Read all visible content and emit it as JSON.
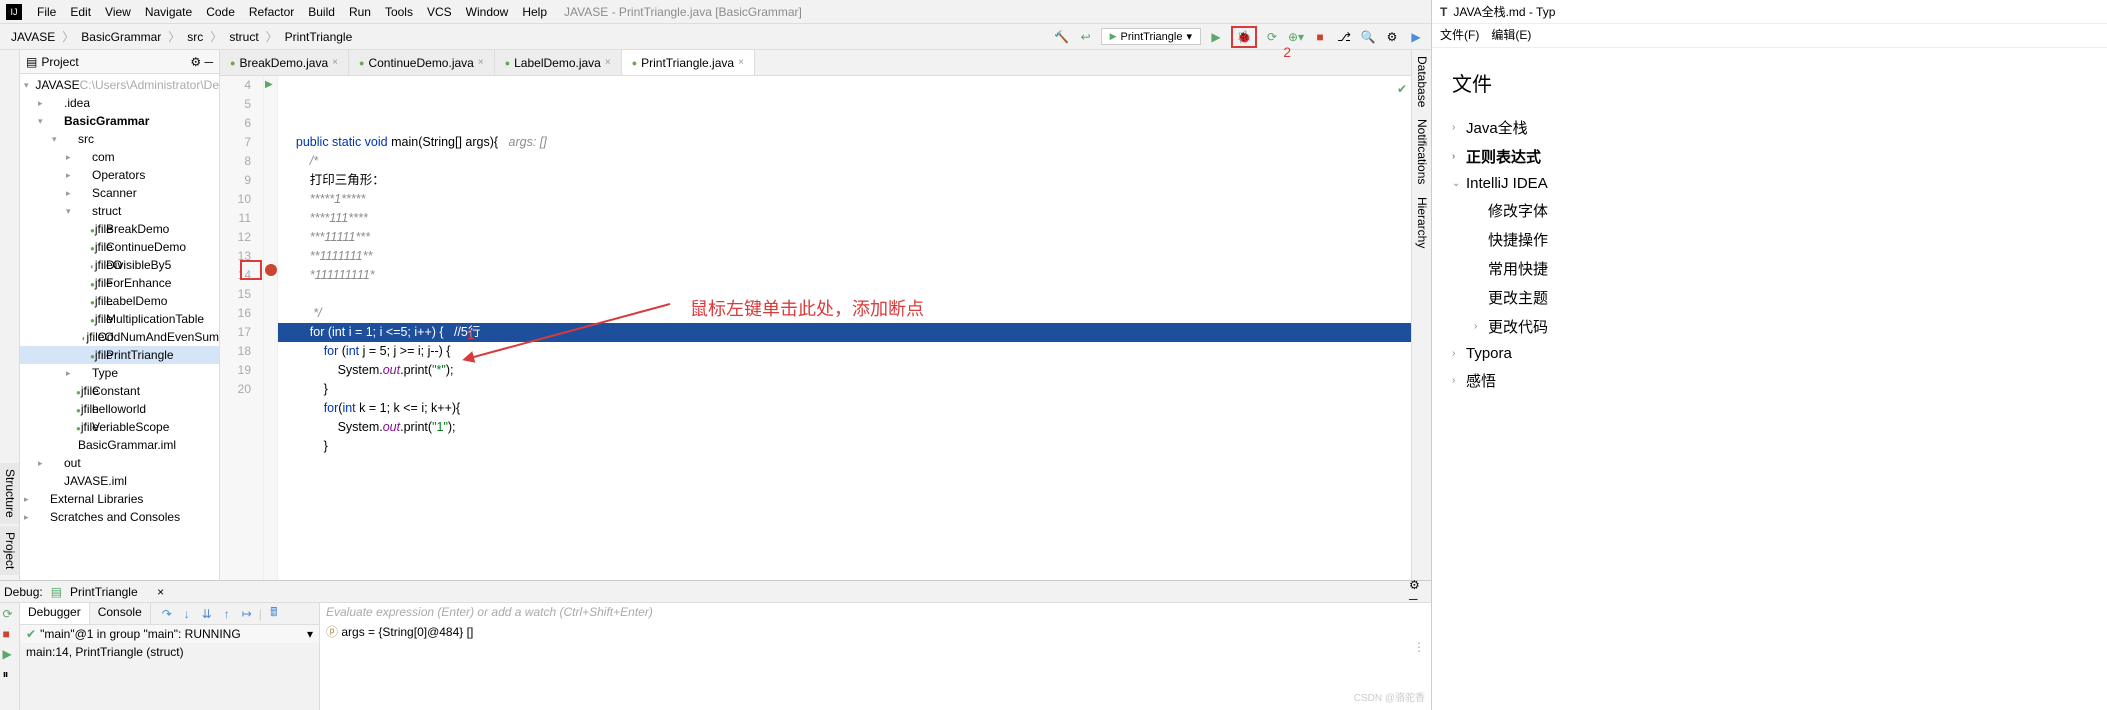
{
  "menubar": {
    "items": [
      "File",
      "Edit",
      "View",
      "Navigate",
      "Code",
      "Refactor",
      "Build",
      "Run",
      "Tools",
      "VCS",
      "Window",
      "Help"
    ],
    "title": "JAVASE - PrintTriangle.java [BasicGrammar]"
  },
  "crumbs": [
    "JAVASE",
    "BasicGrammar",
    "src",
    "struct",
    "PrintTriangle"
  ],
  "run_config": "PrintTriangle",
  "annotations": {
    "label1": "1",
    "label2": "2",
    "text": "鼠标左键单击此处，添加断点"
  },
  "project_tree": {
    "header": "Project",
    "nodes": [
      {
        "d": 0,
        "arrow": "▾",
        "ic": "📁",
        "label": "JAVASE",
        "suffix": "C:\\Users\\Administrator\\De"
      },
      {
        "d": 1,
        "arrow": "▸",
        "ic": "📁",
        "label": ".idea"
      },
      {
        "d": 1,
        "arrow": "▾",
        "ic": "📁",
        "label": "BasicGrammar",
        "bold": true
      },
      {
        "d": 2,
        "arrow": "▾",
        "ic": "📁",
        "label": "src"
      },
      {
        "d": 3,
        "arrow": "▸",
        "ic": "📁",
        "label": "com"
      },
      {
        "d": 3,
        "arrow": "▸",
        "ic": "📁",
        "label": "Operators"
      },
      {
        "d": 3,
        "arrow": "▸",
        "ic": "📁",
        "label": "Scanner"
      },
      {
        "d": 3,
        "arrow": "▾",
        "ic": "📁",
        "label": "struct"
      },
      {
        "d": 4,
        "ic": "jfile",
        "label": "BreakDemo"
      },
      {
        "d": 4,
        "ic": "jfile",
        "label": "ContinueDemo"
      },
      {
        "d": 4,
        "ic": "jfileO",
        "label": "DivisibleBy5"
      },
      {
        "d": 4,
        "ic": "jfile",
        "label": "ForEnhance"
      },
      {
        "d": 4,
        "ic": "jfile",
        "label": "LabelDemo"
      },
      {
        "d": 4,
        "ic": "jfile",
        "label": "MultiplicationTable"
      },
      {
        "d": 4,
        "ic": "jfileO",
        "label": "OddNumAndEvenSum"
      },
      {
        "d": 4,
        "ic": "jfile",
        "label": "PrintTriangle",
        "sel": true
      },
      {
        "d": 3,
        "arrow": "▸",
        "ic": "📁",
        "label": "Type"
      },
      {
        "d": 3,
        "ic": "jfile",
        "label": "Constant"
      },
      {
        "d": 3,
        "ic": "jfile",
        "label": "helloworld"
      },
      {
        "d": 3,
        "ic": "jfile",
        "label": "VeriableScope"
      },
      {
        "d": 2,
        "ic": "⚙",
        "label": "BasicGrammar.iml"
      },
      {
        "d": 1,
        "arrow": "▸",
        "ic": "📁",
        "label": "out",
        "orange": true
      },
      {
        "d": 1,
        "ic": "⚙",
        "label": "JAVASE.iml"
      },
      {
        "d": 0,
        "arrow": "▸",
        "ic": "📚",
        "label": "External Libraries"
      },
      {
        "d": 0,
        "arrow": "▸",
        "ic": "🗂",
        "label": "Scratches and Consoles"
      }
    ]
  },
  "editor": {
    "tabs": [
      {
        "label": "BreakDemo.java"
      },
      {
        "label": "ContinueDemo.java"
      },
      {
        "label": "LabelDemo.java"
      },
      {
        "label": "PrintTriangle.java",
        "active": true
      }
    ],
    "first_line": 4,
    "lines": [
      {
        "n": 4,
        "html": "    <span class='kw'>public static void</span> main(String[] args){   <span class='cmt'>args: []</span>",
        "run": true
      },
      {
        "n": 5,
        "html": "        <span class='cmt'>/*"
      },
      {
        "n": 6,
        "html": "        打印三角形：</span>"
      },
      {
        "n": 7,
        "html": "        <span class='cmt'>*****1*****</span>"
      },
      {
        "n": 8,
        "html": "        <span class='cmt'>****111****</span>"
      },
      {
        "n": 9,
        "html": "        <span class='cmt'>***11111***</span>"
      },
      {
        "n": 10,
        "html": "        <span class='cmt'>**1111111**</span>"
      },
      {
        "n": 11,
        "html": "        <span class='cmt'>*111111111*</span>"
      },
      {
        "n": 12,
        "html": ""
      },
      {
        "n": 13,
        "html": "         <span class='cmt'>*/</span>"
      },
      {
        "n": 14,
        "html": "        <span class='kw'>for</span> (<span class='kw'>int</span> i = 1; i &lt;=5; i++) {   //5行",
        "bp": true
      },
      {
        "n": 15,
        "html": "            <span class='kw'>for</span> (<span class='kw'>int</span> j = 5; j &gt;= i; j--) {"
      },
      {
        "n": 16,
        "html": "                System.<span class='field'>out</span>.print(<span class='str'>\"*\"</span>);"
      },
      {
        "n": 17,
        "html": "            }"
      },
      {
        "n": 18,
        "html": "            <span class='kw'>for</span>(<span class='kw'>int</span> k = 1; k &lt;= i; k++){"
      },
      {
        "n": 19,
        "html": "                System.<span class='field'>out</span>.print(<span class='str'>\"1\"</span>);"
      },
      {
        "n": 20,
        "html": "            }"
      }
    ]
  },
  "right_strip": [
    "Database",
    "Notifications",
    "Hierarchy"
  ],
  "debug": {
    "header": "Debug:",
    "config": "PrintTriangle",
    "tabs": [
      "Debugger",
      "Console"
    ],
    "thread_status": "\"main\"@1 in group \"main\": RUNNING",
    "frame": "main:14, PrintTriangle (struct)",
    "eval_hint": "Evaluate expression (Enter) or add a watch (Ctrl+Shift+Enter)",
    "var": "args = {String[0]@484} []"
  },
  "typora": {
    "title": "JAVA全栈.md - Typ",
    "menus": [
      "文件(F)",
      "编辑(E)"
    ],
    "heading": "文件",
    "outline": [
      {
        "l": 1,
        "chev": "›",
        "label": "Java全栈"
      },
      {
        "l": 1,
        "chev": "›",
        "label": "正则表达式",
        "bold": true
      },
      {
        "l": 1,
        "chev": "⌄",
        "label": "IntelliJ IDEA"
      },
      {
        "l": 2,
        "label": "修改字体"
      },
      {
        "l": 2,
        "label": "快捷操作"
      },
      {
        "l": 2,
        "label": "常用快捷"
      },
      {
        "l": 2,
        "label": "更改主题"
      },
      {
        "l": 2,
        "chev": "›",
        "label": "更改代码"
      },
      {
        "l": 1,
        "chev": "›",
        "label": "Typora"
      },
      {
        "l": 1,
        "chev": "›",
        "label": "感悟"
      }
    ]
  },
  "watermark": "CSDN @骆驼香"
}
